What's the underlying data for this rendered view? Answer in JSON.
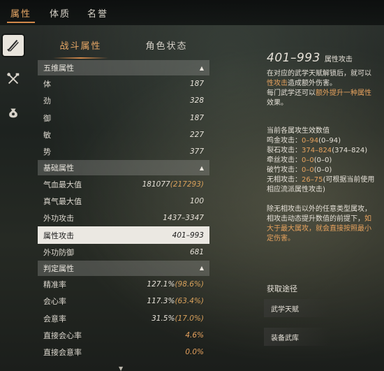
{
  "top_tabs": [
    "属性",
    "体质",
    "名誉"
  ],
  "sub_tabs": [
    "战斗属性",
    "角色状态"
  ],
  "rail_icons": [
    "crossed-swords-icon",
    "crossed-tools-icon",
    "pouch-icon"
  ],
  "sections": {
    "five_dim": {
      "title": "五维属性",
      "rows": [
        {
          "label": "体",
          "value": "187"
        },
        {
          "label": "劲",
          "value": "328"
        },
        {
          "label": "御",
          "value": "187"
        },
        {
          "label": "敏",
          "value": "227"
        },
        {
          "label": "势",
          "value": "377"
        }
      ]
    },
    "basic": {
      "title": "基础属性",
      "rows": [
        {
          "label": "气血最大值",
          "value": "181077",
          "extra": "(217293)"
        },
        {
          "label": "真气最大值",
          "value": "100"
        },
        {
          "label": "外功攻击",
          "value": "1437–3347"
        },
        {
          "label": "属性攻击",
          "value": "401–993"
        },
        {
          "label": "外功防御",
          "value": "681"
        }
      ]
    },
    "judge": {
      "title": "判定属性",
      "rows": [
        {
          "label": "精准率",
          "value": "127.1%",
          "extra": "(98.6%)"
        },
        {
          "label": "会心率",
          "value": "117.3%",
          "extra": "(63.4%)"
        },
        {
          "label": "会意率",
          "value": "31.5%",
          "extra": "(17.0%)"
        },
        {
          "label": "直接会心率",
          "value": "4.6%"
        },
        {
          "label": "直接会意率",
          "value": "0.0%"
        }
      ]
    }
  },
  "detail": {
    "range": "401–993",
    "range_label": "属性攻击",
    "p1": [
      "在对应的武学天赋解锁后，就可以",
      "性攻击",
      "造成额外伤害。",
      "每门武学还可以",
      "额外提升一种属性",
      "效果。"
    ],
    "current_title": "当前各属攻生效数值",
    "attacks": [
      {
        "label": "鸣金攻击：",
        "value": "0–94",
        "paren": "(0–94)"
      },
      {
        "label": "裂石攻击：",
        "value": "374–824",
        "paren": "(374–824)"
      },
      {
        "label": "牵丝攻击：",
        "value": "0–0",
        "paren": "(0–0)"
      },
      {
        "label": "破竹攻击：",
        "value": "0–0",
        "paren": "(0–0)"
      },
      {
        "label": "无相攻击：",
        "value": "26–75",
        "paren": "(可根据当前使用"
      }
    ],
    "wuxiang_note": "相应流派属性攻击)",
    "p3": [
      "除无相攻击以外的任意类型属攻，",
      "相攻击动态提升数值的前提下，",
      "如",
      "大于最大属攻，就会直接按照最小",
      "定伤害。"
    ],
    "acquire_title": "获取途径",
    "acquire_items": [
      "武学天赋",
      "装备武库"
    ]
  }
}
